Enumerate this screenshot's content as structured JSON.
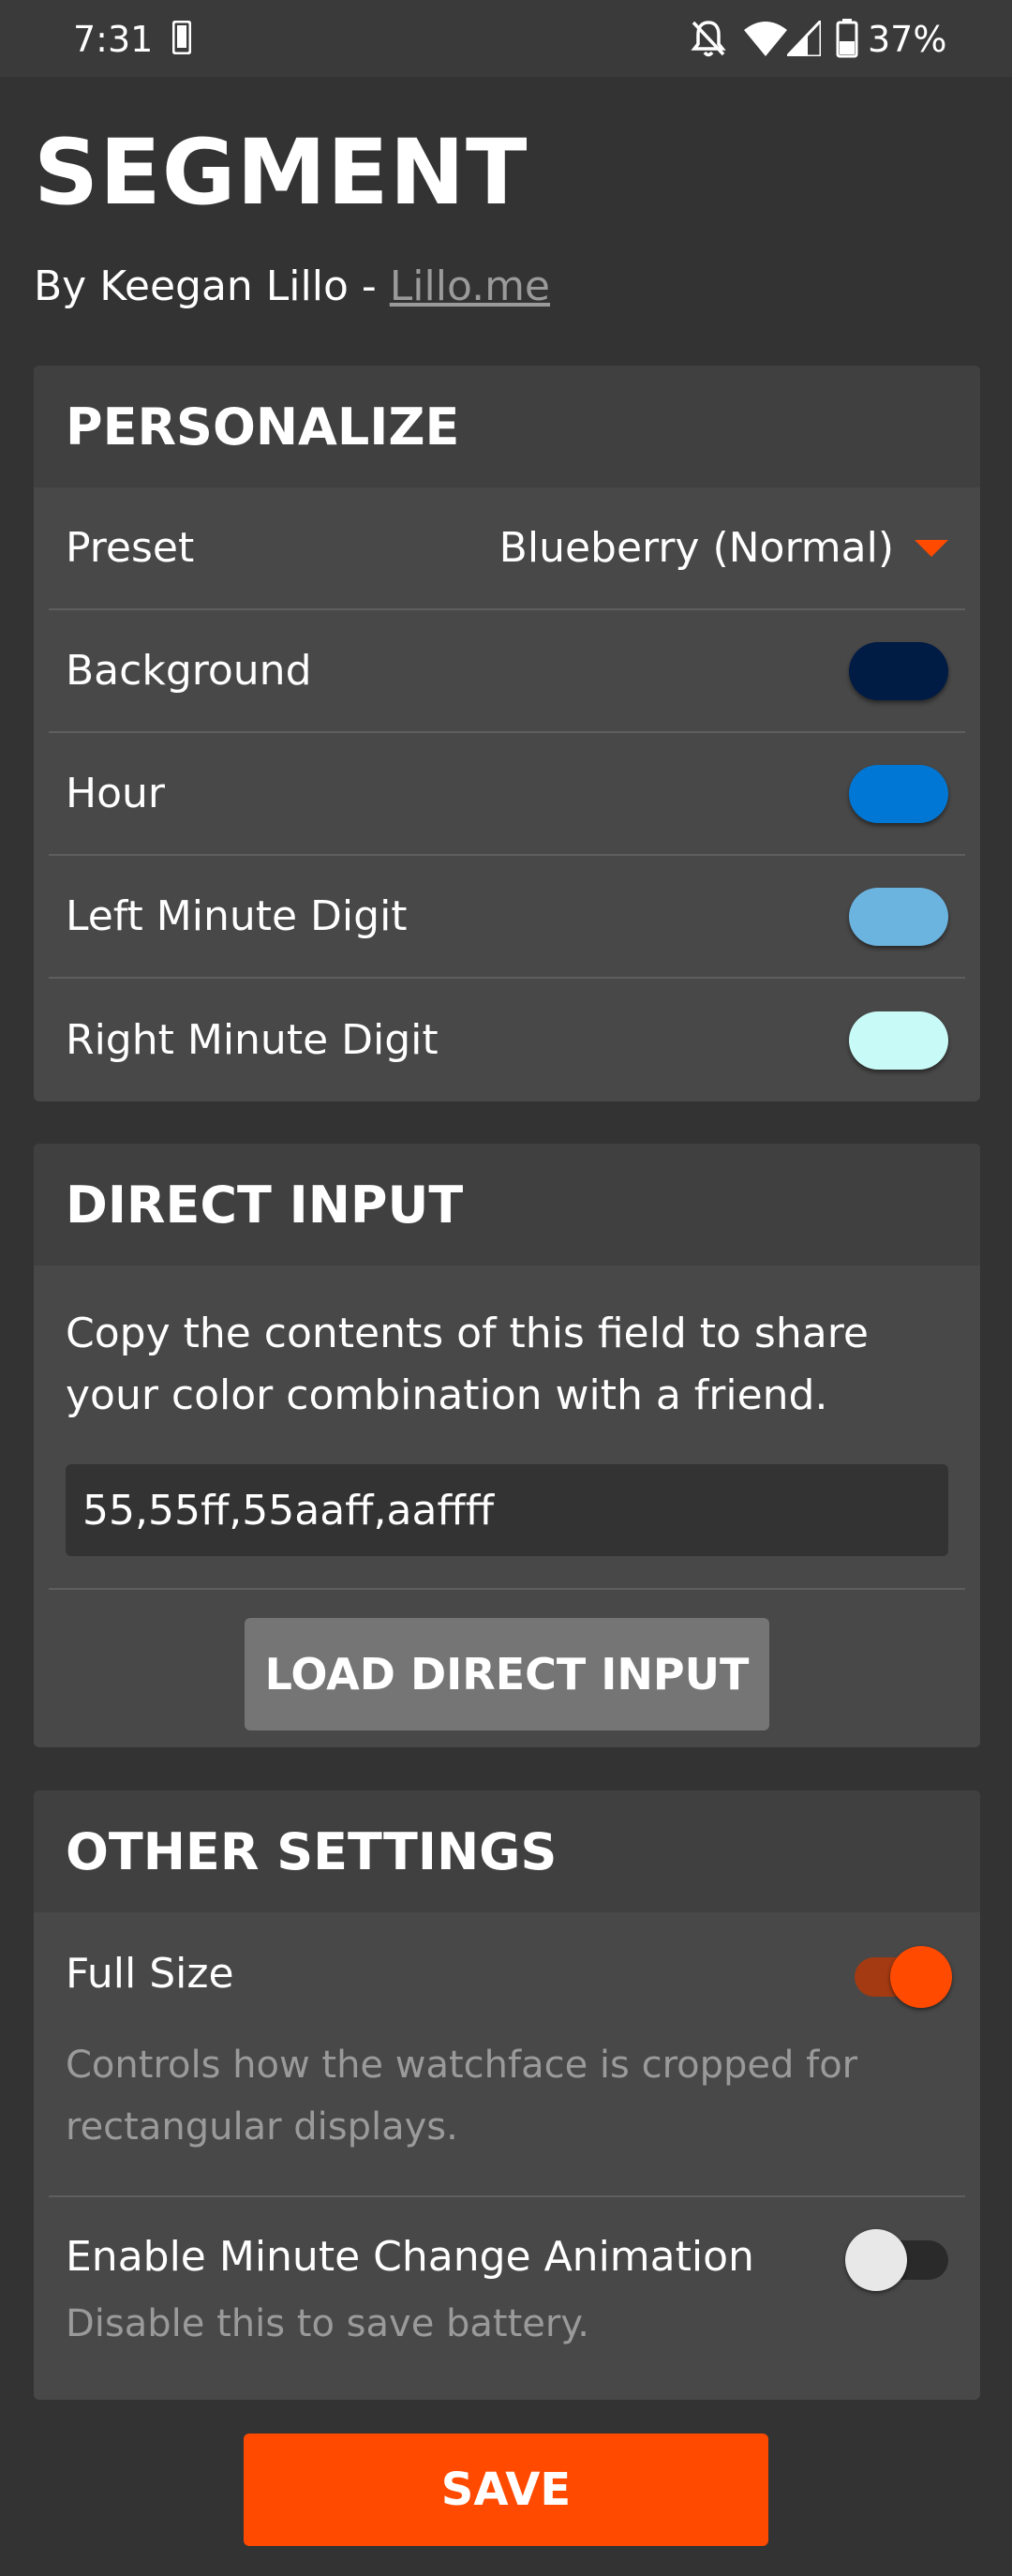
{
  "status_bar": {
    "time": "7:31",
    "battery": "37%",
    "icons": [
      "phone-icon",
      "bell-off-icon",
      "wifi-icon",
      "signal-icon",
      "battery-icon"
    ]
  },
  "app": {
    "title": "SEGMENT",
    "byline_prefix": "By Keegan Lillo - ",
    "byline_link": "Lillo.me"
  },
  "personalize": {
    "header": "PERSONALIZE",
    "preset_label": "Preset",
    "preset_value": "Blueberry (Normal)",
    "colors": [
      {
        "label": "Background",
        "color": "#001b44"
      },
      {
        "label": "Hour",
        "color": "#0077d4"
      },
      {
        "label": "Left Minute Digit",
        "color": "#6cb4e0"
      },
      {
        "label": "Right Minute Digit",
        "color": "#c8fbf7"
      }
    ]
  },
  "direct_input": {
    "header": "DIRECT INPUT",
    "description": "Copy the contents of this field to share your color combination with a friend.",
    "value": "55,55ff,55aaff,aaffff",
    "button": "LOAD DIRECT INPUT"
  },
  "other_settings": {
    "header": "OTHER SETTINGS",
    "full_size": {
      "label": "Full Size",
      "help": "Controls how the watchface is cropped for rectangular displays.",
      "enabled": true
    },
    "minute_animation": {
      "label": "Enable Minute Change Animation",
      "help": "Disable this to save battery.",
      "enabled": false
    }
  },
  "save_button": "SAVE",
  "accent_color": "#ff4a00"
}
